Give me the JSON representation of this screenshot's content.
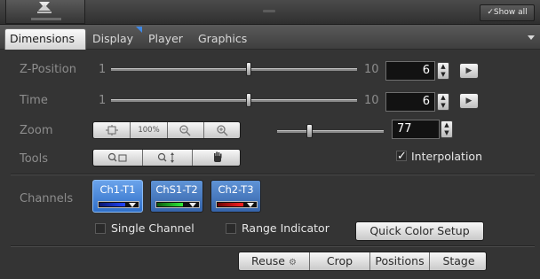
{
  "header": {
    "show_all_label": "✓Show all"
  },
  "tabs": [
    {
      "label": "Dimensions"
    },
    {
      "label": "Display"
    },
    {
      "label": "Player"
    },
    {
      "label": "Graphics"
    }
  ],
  "z_position": {
    "label": "Z-Position",
    "min": "1",
    "max": "10",
    "value": "6",
    "slider_fraction": 0.56
  },
  "time": {
    "label": "Time",
    "min": "1",
    "max": "10",
    "value": "6",
    "slider_fraction": 0.56
  },
  "zoom": {
    "label": "Zoom",
    "buttons": [
      "fit-icon",
      "100%",
      "zoom-out-icon",
      "zoom-in-icon"
    ],
    "value": "77",
    "slider_fraction": 0.45
  },
  "tools": {
    "label": "Tools",
    "buttons": [
      "zoom-rect-icon",
      "zoom-vertical-icon",
      "hand-icon"
    ],
    "interpolation_label": "Interpolation",
    "interpolation_checked": true
  },
  "channels": {
    "label": "Channels",
    "items": [
      {
        "name": "Ch1-T1",
        "color": "#1a3bd8"
      },
      {
        "name": "ChS1-T2",
        "color": "#1fd22a"
      },
      {
        "name": "Ch2-T3",
        "color": "#e01818"
      }
    ],
    "single_channel_label": "Single Channel",
    "range_indicator_label": "Range Indicator",
    "quick_color_setup_label": "Quick Color Setup"
  },
  "footer_buttons": {
    "reuse": "Reuse",
    "crop": "Crop",
    "positions": "Positions",
    "stage": "Stage"
  }
}
